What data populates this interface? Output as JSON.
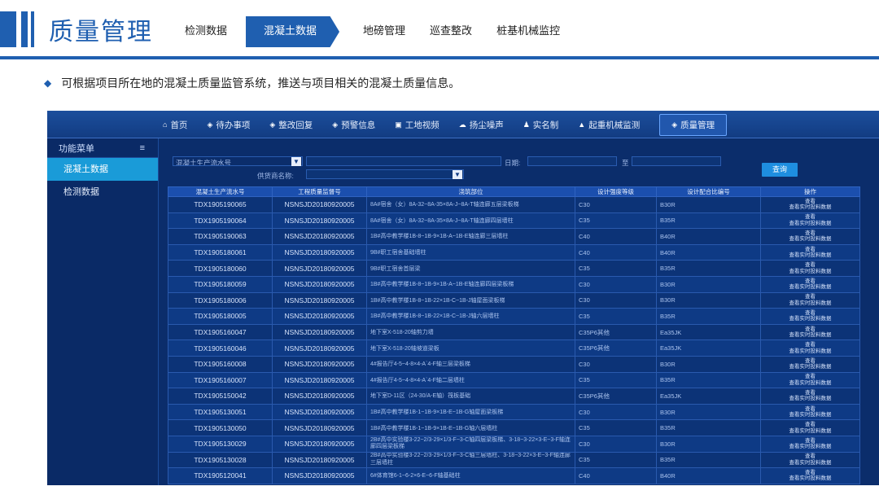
{
  "slide": {
    "title": "质量管理",
    "tabs": [
      {
        "label": "检测数据",
        "active": false
      },
      {
        "label": "混凝土数据",
        "active": true
      },
      {
        "label": "地磅管理",
        "active": false
      },
      {
        "label": "巡查整改",
        "active": false
      },
      {
        "label": "桩基机械监控",
        "active": false
      }
    ],
    "bullet": "可根据项目所在地的混凝土质量监管系统，推送与项目相关的混凝土质量信息。"
  },
  "app": {
    "nav": [
      {
        "icon": "home-icon",
        "label": "首页"
      },
      {
        "icon": "shield-icon",
        "label": "待办事项"
      },
      {
        "icon": "shield-icon",
        "label": "整改回复"
      },
      {
        "icon": "shield-icon",
        "label": "预警信息"
      },
      {
        "icon": "video-icon",
        "label": "工地视频"
      },
      {
        "icon": "cloud-icon",
        "label": "扬尘噪声"
      },
      {
        "icon": "people-icon",
        "label": "实名制"
      },
      {
        "icon": "crane-icon",
        "label": "起重机械监测"
      },
      {
        "icon": "shield-icon",
        "label": "质量管理"
      }
    ],
    "sidebar": {
      "title": "功能菜单",
      "items": [
        {
          "label": "混凝土数据",
          "active": true
        },
        {
          "label": "检测数据",
          "active": false
        }
      ]
    },
    "filters": {
      "select_label": "混凝土生产流水号",
      "date_label": "日期:",
      "to_label": "至",
      "supplier_label": "供货商名称:",
      "query_button": "查询"
    },
    "table": {
      "headers": [
        "混凝土生产流水号",
        "工程质量监督号",
        "浇筑部位",
        "设计强度等级",
        "设计配合比编号",
        "操作"
      ],
      "op_view": "查看",
      "op_detail": "查看实时投料数据",
      "rows": [
        {
          "no": "TDX1905190065",
          "qa": "NSNSJD20180920005",
          "pos": "8A#宿舍（女）8A-32~8A-35×8A-J~8A-T轴连廊五层梁板梯",
          "grade": "C30",
          "mix": "B30R"
        },
        {
          "no": "TDX1905190064",
          "qa": "NSNSJD20180920005",
          "pos": "8A#宿舍（女）8A-32~8A-35×8A-J~8A-T轴连廊四层墙柱",
          "grade": "C35",
          "mix": "B35R"
        },
        {
          "no": "TDX1905190063",
          "qa": "NSNSJD20180920005",
          "pos": "1B#高中教学楼1B-8~1B-9×1B-A~1B-E轴连廊三层墙柱",
          "grade": "C40",
          "mix": "B40R"
        },
        {
          "no": "TDX1905180061",
          "qa": "NSNSJD20180920005",
          "pos": "9B#职工宿舍基础墙柱",
          "grade": "C40",
          "mix": "B40R"
        },
        {
          "no": "TDX1905180060",
          "qa": "NSNSJD20180920005",
          "pos": "9B#职工宿舍首层梁",
          "grade": "C35",
          "mix": "B35R"
        },
        {
          "no": "TDX1905180059",
          "qa": "NSNSJD20180920005",
          "pos": "1B#高中教学楼1B-8~1B-9×1B-A~1B-E轴连廊四层梁板梯",
          "grade": "C30",
          "mix": "B30R"
        },
        {
          "no": "TDX1905180006",
          "qa": "NSNSJD20180920005",
          "pos": "1B#高中教学楼1B-8~1B-22×1B-C~1B-J轴屋面梁板梯",
          "grade": "C30",
          "mix": "B30R"
        },
        {
          "no": "TDX1905180005",
          "qa": "NSNSJD20180920005",
          "pos": "1B#高中教学楼1B-8~1B-22×1B-C~1B-J轴六层墙柱",
          "grade": "C35",
          "mix": "B35R"
        },
        {
          "no": "TDX1905160047",
          "qa": "NSNSJD20180920005",
          "pos": "地下室X-518-20轴剪力墙",
          "grade": "C35P6其他",
          "mix": "Ea35JK"
        },
        {
          "no": "TDX1905160046",
          "qa": "NSNSJD20180920005",
          "pos": "地下室X-518-20轴坡道梁板",
          "grade": "C35P6其他",
          "mix": "Ea35JK"
        },
        {
          "no": "TDX1905160008",
          "qa": "NSNSJD20180920005",
          "pos": "4#报告厅4-5~4-8×4-A`4-F轴三层梁板梯",
          "grade": "C30",
          "mix": "B30R"
        },
        {
          "no": "TDX1905160007",
          "qa": "NSNSJD20180920005",
          "pos": "4#报告厅4-5~4-8×4-A`4-F轴二层墙柱",
          "grade": "C35",
          "mix": "B35R"
        },
        {
          "no": "TDX1905150042",
          "qa": "NSNSJD20180920005",
          "pos": "地下室D-11区（24-30/A-E轴）筏板基础",
          "grade": "C35P6其他",
          "mix": "Ea35JK"
        },
        {
          "no": "TDX1905130051",
          "qa": "NSNSJD20180920005",
          "pos": "1B#高中教学楼1B-1~1B-9×1B-E~1B-G轴屋面梁板梯",
          "grade": "C30",
          "mix": "B30R"
        },
        {
          "no": "TDX1905130050",
          "qa": "NSNSJD20180920005",
          "pos": "1B#高中教学楼1B-1~1B-9×1B-E~1B-G轴六层墙柱",
          "grade": "C35",
          "mix": "B35R"
        },
        {
          "no": "TDX1905130029",
          "qa": "NSNSJD20180920005",
          "pos": "2B#高中实验楼3-22~2/3-29×1/3-F~3-C轴四层梁板梯、3-18~3-22×3-E~3-F轴连廊四层梁板梯",
          "grade": "C30",
          "mix": "B30R"
        },
        {
          "no": "TDX1905130028",
          "qa": "NSNSJD20180920005",
          "pos": "2B#高中实验楼3-22~2/3-29×1/3-F~3-C轴三层墙柱、3-18~3-22×3-E~3-F轴连廊三层墙柱",
          "grade": "C35",
          "mix": "B35R"
        },
        {
          "no": "TDX1905120041",
          "qa": "NSNSJD20180920005",
          "pos": "6#体育馆6-1~6-2×6-E~6-F轴基础柱",
          "grade": "C40",
          "mix": "B40R"
        }
      ]
    }
  }
}
